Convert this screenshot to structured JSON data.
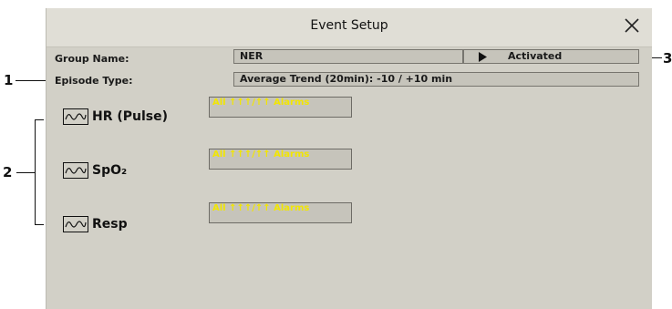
{
  "dialog": {
    "title": "Event Setup"
  },
  "group": {
    "label": "Group Name:",
    "value": "NER",
    "status": "Activated"
  },
  "episode": {
    "label": "Episode Type:",
    "value": "Average Trend (20min): -10 / +10 min"
  },
  "params": [
    {
      "name": "HR (Pulse)",
      "alarm": "All ↑↑↑/↑↑ Alarms"
    },
    {
      "name": "SpO₂",
      "alarm": "All ↑↑↑/↑↑ Alarms"
    },
    {
      "name": "Resp",
      "alarm": "All ↑↑↑/↑↑ Alarms"
    }
  ],
  "callouts": {
    "one": "1",
    "two": "2",
    "three": "3"
  }
}
